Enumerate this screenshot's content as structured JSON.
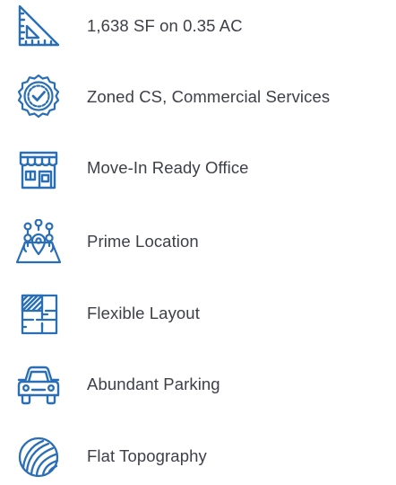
{
  "theme": {
    "icon_color": "#2a6fb6",
    "text_color": "#3e4047"
  },
  "features": [
    {
      "label": "1,638 SF on 0.35 AC",
      "icon": "ruler-triangle-icon"
    },
    {
      "label": "Zoned CS, Commercial Services",
      "icon": "certified-badge-icon"
    },
    {
      "label": "Move-In Ready Office",
      "icon": "storefront-icon"
    },
    {
      "label": "Prime Location",
      "icon": "map-pins-icon"
    },
    {
      "label": "Flexible Layout",
      "icon": "floor-plan-icon"
    },
    {
      "label": "Abundant Parking",
      "icon": "car-icon"
    },
    {
      "label": "Flat Topography",
      "icon": "topography-icon"
    }
  ]
}
